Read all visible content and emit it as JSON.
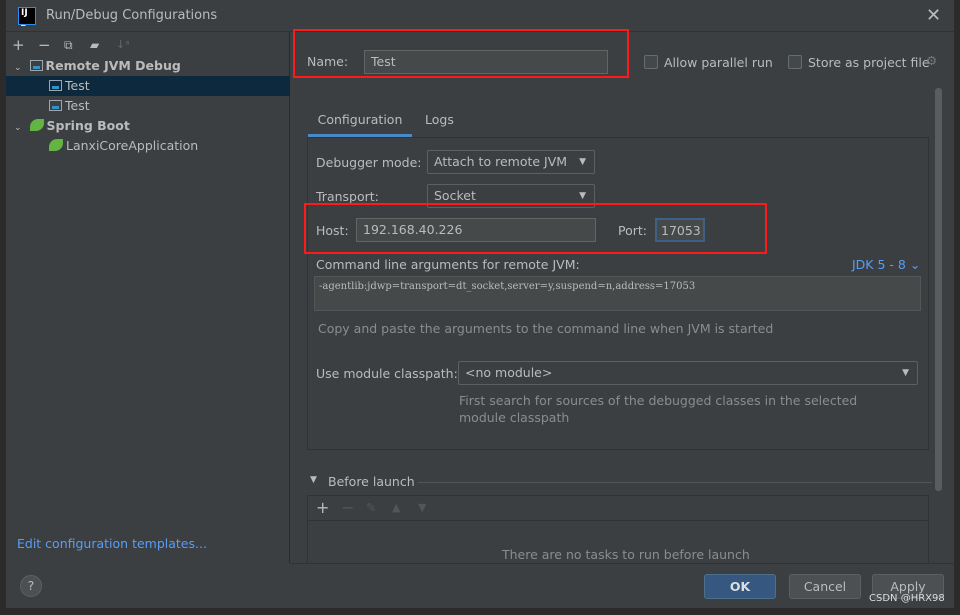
{
  "window": {
    "title": "Run/Debug Configurations",
    "logo_text": "IJ"
  },
  "sidebar": {
    "toolbar": [
      "add-icon",
      "remove-icon",
      "copy-icon",
      "new-folder-icon",
      "sort-icon"
    ],
    "tree": [
      {
        "label": "Remote JVM Debug",
        "type": "group"
      },
      {
        "label": "Test",
        "type": "item",
        "selected": true
      },
      {
        "label": "Test",
        "type": "item"
      },
      {
        "label": "Spring Boot",
        "type": "group"
      },
      {
        "label": "LanxiCoreApplication",
        "type": "item"
      }
    ],
    "edit_templates": "Edit configuration templates..."
  },
  "header": {
    "name_label": "Name:",
    "name_value": "Test",
    "allow_parallel": "Allow parallel run",
    "store_project": "Store as project file",
    "allow_parallel_checked": false,
    "store_project_checked": false
  },
  "tabs": [
    {
      "label": "Configuration",
      "active": true
    },
    {
      "label": "Logs"
    }
  ],
  "config": {
    "debugger_mode_label": "Debugger mode:",
    "debugger_mode": "Attach to remote JVM",
    "transport_label": "Transport:",
    "transport": "Socket",
    "host_label": "Host:",
    "host": "192.168.40.226",
    "port_label": "Port:",
    "port": "17053",
    "cmd_label": "Command line arguments for remote JVM:",
    "jdk": "JDK 5 - 8",
    "cmd_value": "-agentlib:jdwp=transport=dt_socket,server=y,suspend=n,address=17053",
    "cmd_hint": "Copy and paste the arguments to the command line when JVM is started",
    "module_label": "Use module classpath:",
    "module": "<no module>",
    "module_hint_1": "First search for sources of the debugged classes in the selected",
    "module_hint_2": "module classpath"
  },
  "before_launch": {
    "label": "Before launch",
    "empty": "There are no tasks to run before launch"
  },
  "footer": {
    "help": "?",
    "ok": "OK",
    "cancel": "Cancel",
    "apply": "Apply"
  },
  "watermark": "CSDN @HRX98",
  "colors": {
    "accent": "#365880",
    "highlight": "#ff1a1a",
    "link": "#589df6",
    "selection": "#0d293e"
  }
}
